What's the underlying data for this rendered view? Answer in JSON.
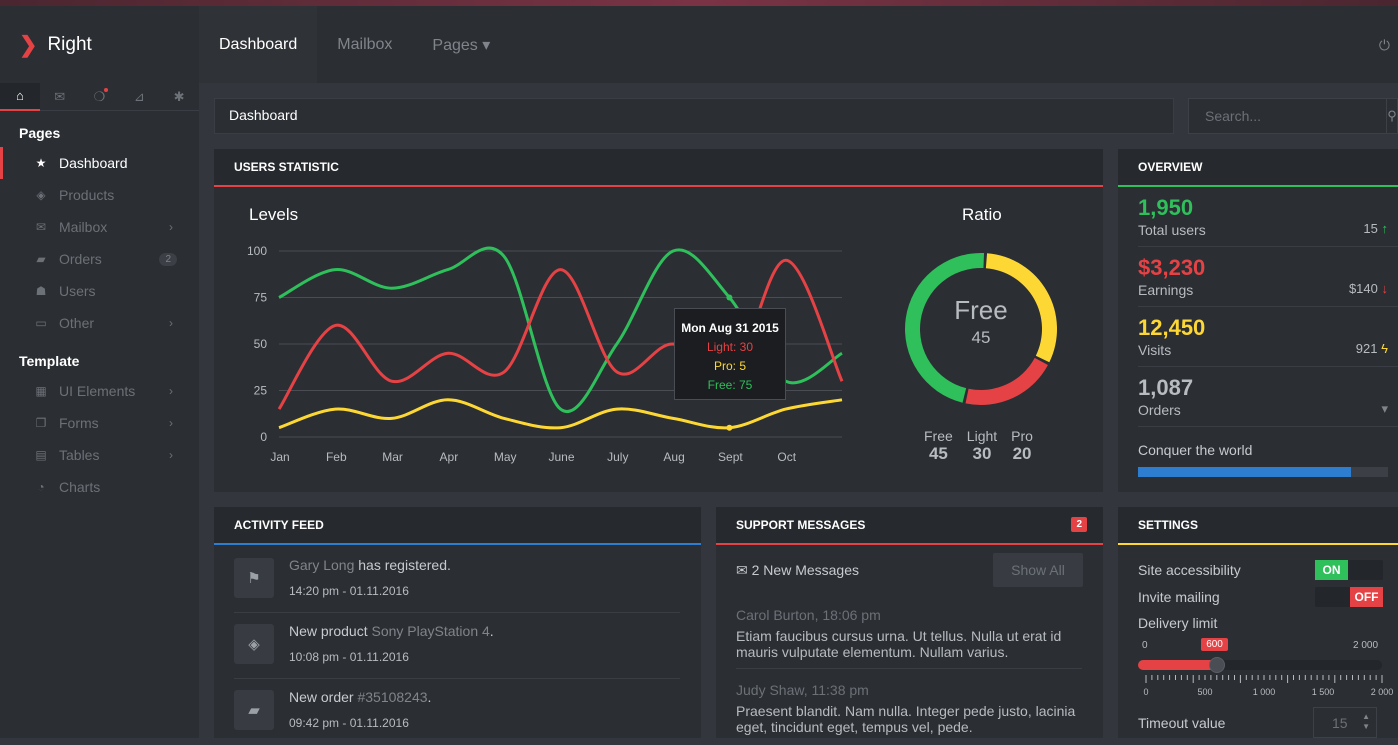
{
  "brand": {
    "name": "Right"
  },
  "sidebar": {
    "tabs": [
      {
        "icon": "home-icon",
        "glyph": "⌂"
      },
      {
        "icon": "envelope-icon",
        "glyph": "✉"
      },
      {
        "icon": "chat-icon",
        "glyph": "❍"
      },
      {
        "icon": "rss-icon",
        "glyph": "⊿"
      },
      {
        "icon": "gear-icon",
        "glyph": "✱"
      }
    ],
    "section_pages": "Pages",
    "section_template": "Template",
    "pages": [
      {
        "label": "Dashboard",
        "icon": "star-icon",
        "glyph": "★"
      },
      {
        "label": "Products",
        "icon": "cube-icon",
        "glyph": "◈"
      },
      {
        "label": "Mailbox",
        "icon": "envelope-icon",
        "glyph": "✉"
      },
      {
        "label": "Orders",
        "icon": "truck-icon",
        "glyph": "▰",
        "badge": "2"
      },
      {
        "label": "Users",
        "icon": "user-icon",
        "glyph": "☗"
      },
      {
        "label": "Other",
        "icon": "folder-icon",
        "glyph": "▭"
      }
    ],
    "template": [
      {
        "label": "UI Elements",
        "icon": "grid-icon",
        "glyph": "▦"
      },
      {
        "label": "Forms",
        "icon": "copy-icon",
        "glyph": "❐"
      },
      {
        "label": "Tables",
        "icon": "table-icon",
        "glyph": "▤"
      },
      {
        "label": "Charts",
        "icon": "pie-chart-icon",
        "glyph": "◔"
      }
    ]
  },
  "topbar": {
    "tabs": [
      "Dashboard",
      "Mailbox",
      "Pages ▾"
    ]
  },
  "breadcrumb": "Dashboard",
  "search": {
    "placeholder": "Search..."
  },
  "users_statistic": {
    "title": "USERS STATISTIC",
    "levels_title": "Levels",
    "ratio_title": "Ratio",
    "tooltip": {
      "date": "Mon Aug 31 2015",
      "light": "Light: 30",
      "pro": "Pro: 5",
      "free": "Free: 75"
    },
    "donut_center": {
      "label": "Free",
      "value": "45"
    },
    "ratio_legend": [
      {
        "label": "Free",
        "value": "45"
      },
      {
        "label": "Light",
        "value": "30"
      },
      {
        "label": "Pro",
        "value": "20"
      }
    ]
  },
  "chart_data": {
    "type": "line",
    "title": "Levels",
    "categories": [
      "Jan",
      "Feb",
      "Mar",
      "Apr",
      "May",
      "June",
      "July",
      "Aug",
      "Sept",
      "Oct"
    ],
    "ylim": [
      0,
      100
    ],
    "yticks": [
      0,
      25,
      50,
      75,
      100
    ],
    "series": [
      {
        "name": "Free",
        "color": "#2fbf5b",
        "values": [
          75,
          90,
          80,
          90,
          97,
          15,
          50,
          100,
          75,
          30,
          45
        ]
      },
      {
        "name": "Light",
        "color": "#e54245",
        "values": [
          15,
          60,
          30,
          45,
          35,
          90,
          35,
          50,
          30,
          95,
          30
        ]
      },
      {
        "name": "Pro",
        "color": "#fdd835",
        "values": [
          5,
          15,
          10,
          20,
          10,
          5,
          15,
          10,
          5,
          15,
          20
        ]
      }
    ],
    "donut": {
      "type": "pie",
      "labels": [
        "Free",
        "Light",
        "Pro"
      ],
      "values": [
        45,
        30,
        20
      ],
      "colors": [
        "#2fbf5b",
        "#fdd835",
        "#e54245"
      ]
    },
    "grid": true
  },
  "overview": {
    "title": "OVERVIEW",
    "items": [
      {
        "value": "1,950",
        "label": "Total users",
        "side": "15",
        "side_icon": "arrow-up-icon",
        "side_glyph": "↑",
        "color": "#2fbf5b"
      },
      {
        "value": "$3,230",
        "label": "Earnings",
        "side": "$140",
        "side_icon": "arrow-down-icon",
        "side_glyph": "↓",
        "color": "#e54245"
      },
      {
        "value": "12,450",
        "label": "Visits",
        "side": "921",
        "side_icon": "bolt-icon",
        "side_glyph": "ϟ",
        "color": "#fdd835"
      },
      {
        "value": "1,087",
        "label": "Orders",
        "side": "",
        "side_icon": "pin-icon",
        "side_glyph": "✈",
        "color": "#b7bcc1"
      }
    ],
    "goal_label": "Conquer the world",
    "goal_progress": 0.85
  },
  "activity": {
    "title": "ACTIVITY FEED",
    "items": [
      {
        "icon": "flag-icon",
        "glyph": "⚑",
        "pre": "",
        "link": "Gary Long",
        "post": " has registered.",
        "time": "14:20 pm - 01.11.2016"
      },
      {
        "icon": "cube-icon",
        "glyph": "◈",
        "pre": "New product ",
        "link": "Sony PlayStation 4",
        "post": ".",
        "time": "10:08 pm - 01.11.2016"
      },
      {
        "icon": "truck-icon",
        "glyph": "▰",
        "pre": "New order ",
        "link": "#35108243",
        "post": ".",
        "time": "09:42 pm - 01.11.2016"
      }
    ]
  },
  "support": {
    "title": "SUPPORT MESSAGES",
    "badge": "2",
    "new_messages": "2 New Messages",
    "show_all": "Show All",
    "messages": [
      {
        "name": "Carol Burton",
        "time": ", 18:06 pm",
        "body": "Etiam faucibus cursus urna. Ut tellus. Nulla ut erat id mauris vulputate elementum. Nullam varius."
      },
      {
        "name": "Judy Shaw",
        "time": ", 11:38 pm",
        "body": "Praesent blandit. Nam nulla. Integer pede justo, lacinia eget, tincidunt eget, tempus vel, pede."
      }
    ]
  },
  "settings": {
    "title": "SETTINGS",
    "site_accessibility": "Site accessibility",
    "on": "ON",
    "invite_mailing": "Invite mailing",
    "off": "OFF",
    "delivery_limit": "Delivery limit",
    "slider_min": "0",
    "slider_value": "600",
    "slider_max": "2 000",
    "slider_fraction": 0.3,
    "slider_ticks": [
      "0",
      "500",
      "1 000",
      "1 500",
      "2 000"
    ],
    "timeout_label": "Timeout value",
    "timeout_value": "15"
  }
}
